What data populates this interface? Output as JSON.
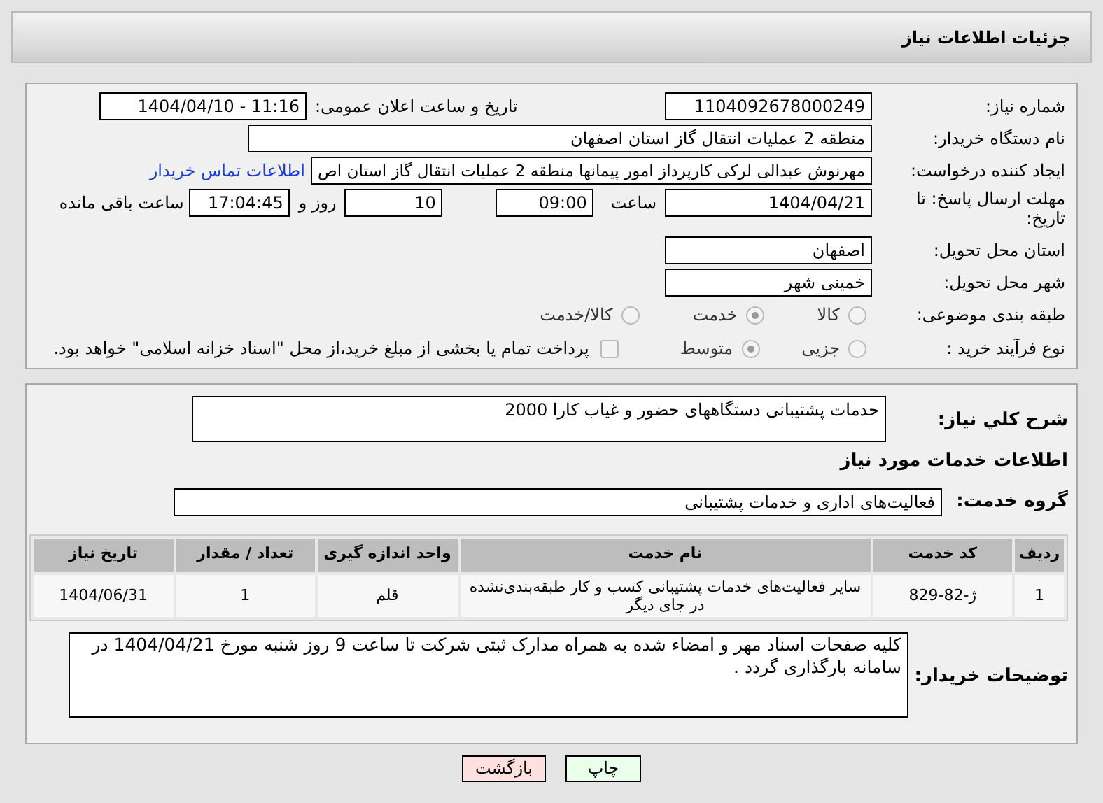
{
  "header": {
    "title": "جزئیات اطلاعات نیاز"
  },
  "need_number": {
    "label": "شماره نیاز:",
    "value": "1104092678000249"
  },
  "announce": {
    "label": "تاریخ و ساعت اعلان عمومی:",
    "value": "1404/04/10 - 11:16"
  },
  "buyer": {
    "label": "نام دستگاه خریدار:",
    "value": "منطقه 2 عملیات انتقال گاز استان اصفهان"
  },
  "creator": {
    "label": "ایجاد کننده درخواست:",
    "value": "مهرنوش عبدالی لرکی کارپرداز امور پیمانها منطقه 2 عملیات انتقال گاز استان اص",
    "link": "اطلاعات تماس خریدار"
  },
  "deadline": {
    "label": "مهلت ارسال پاسخ: تا تاریخ:",
    "date": "1404/04/21",
    "time_label": "ساعت",
    "time": "09:00",
    "days": "10",
    "days_label": "روز و",
    "remaining": "17:04:45",
    "remaining_label": "ساعت باقی مانده"
  },
  "province": {
    "label": "استان محل تحویل:",
    "value": "اصفهان"
  },
  "city": {
    "label": "شهر محل تحویل:",
    "value": "خمینی شهر"
  },
  "category": {
    "label": "طبقه بندی موضوعی:",
    "options": [
      {
        "label": "کالا",
        "selected": false
      },
      {
        "label": "خدمت",
        "selected": true
      },
      {
        "label": "کالا/خدمت",
        "selected": false
      }
    ]
  },
  "process": {
    "label": "نوع فرآیند خرید :",
    "options": [
      {
        "label": "جزیی",
        "selected": false
      },
      {
        "label": "متوسط",
        "selected": true
      }
    ],
    "treasury": {
      "label": "پرداخت تمام یا بخشی از مبلغ خرید،از محل \"اسناد خزانه اسلامی\" خواهد بود.",
      "checked": false
    }
  },
  "description": {
    "label": "شرح کلي نياز:",
    "value": "حدمات پشتیبانی دستگاههای حضور و غیاب کارا 2000"
  },
  "services_heading": "اطلاعات خدمات مورد نیاز",
  "service_group": {
    "label": "گروه خدمت:",
    "value": "فعالیت‌های اداری و خدمات پشتیبانی"
  },
  "table": {
    "columns": [
      "ردیف",
      "کد خدمت",
      "نام خدمت",
      "واحد اندازه گیری",
      "تعداد / مقدار",
      "تاریخ نیاز"
    ],
    "rows": [
      [
        "1",
        "ژ-82-829",
        "سایر فعالیت‌های خدمات پشتیبانی کسب و کار طبقه‌بندی‌نشده در جای دیگر",
        "قلم",
        "1",
        "1404/06/31"
      ]
    ]
  },
  "buyer_notes": {
    "label": "توضیحات خریدار:",
    "value": "کلیه صفحات اسناد مهر و امضاء شده به همراه مدارک ثبتی شرکت تا ساعت 9 روز شنبه مورخ 1404/04/21 در سامانه بارگذاری گردد ."
  },
  "buttons": [
    {
      "label": "چاپ",
      "kind": "print"
    },
    {
      "label": "بازگشت",
      "kind": "back"
    }
  ]
}
